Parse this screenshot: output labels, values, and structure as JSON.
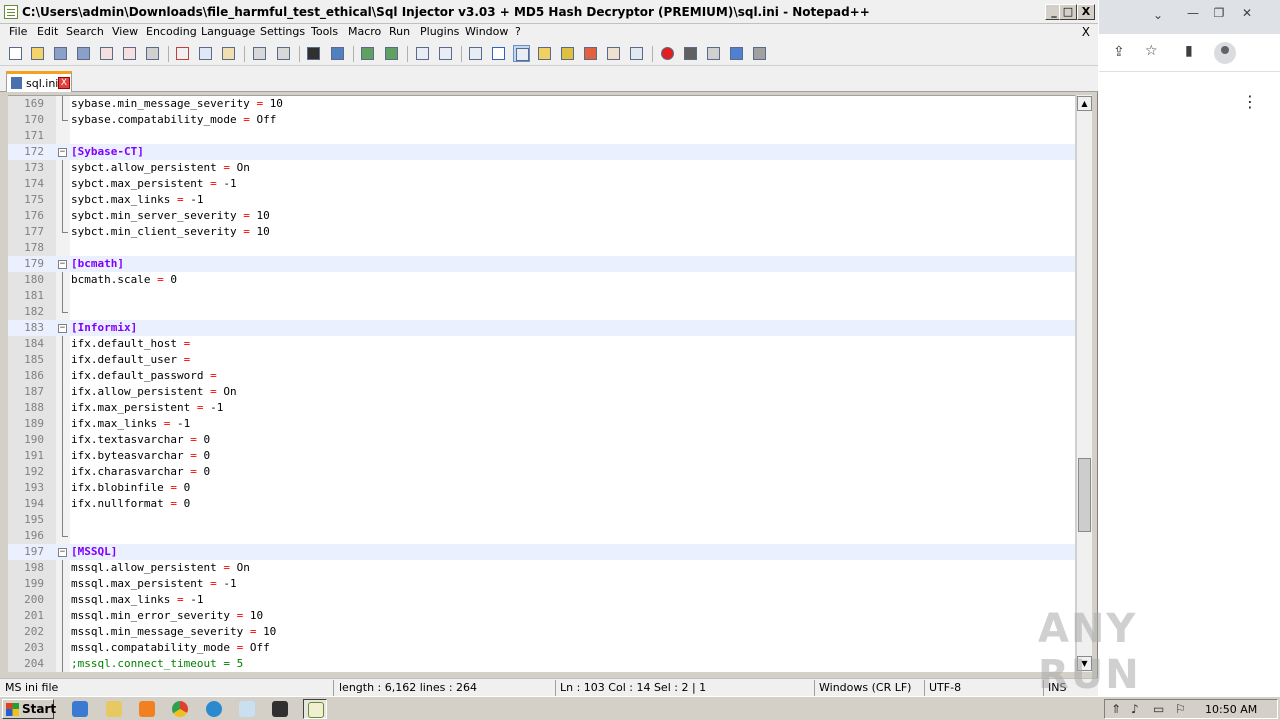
{
  "window": {
    "title": "C:\\Users\\admin\\Downloads\\file_harmful_test_ethical\\Sql Injector v3.03 + MD5 Hash Decryptor (PREMIUM)\\sql.ini - Notepad++",
    "min_label": "_",
    "max_label": "□",
    "close_label": "X"
  },
  "menu": {
    "items": [
      "File",
      "Edit",
      "Search",
      "View",
      "Encoding",
      "Language",
      "Settings",
      "Tools",
      "Macro",
      "Run",
      "Plugins",
      "Window",
      "?"
    ],
    "close_doc": "X"
  },
  "toolbar": {
    "icons": [
      "new-file-icon",
      "open-file-icon",
      "save-icon",
      "save-all-icon",
      "close-icon",
      "close-all-icon",
      "print-icon",
      "cut-icon",
      "copy-icon",
      "paste-icon",
      "undo-icon",
      "redo-icon",
      "find-icon",
      "replace-icon",
      "zoom-in-icon",
      "zoom-out-icon",
      "sync-vertical-icon",
      "sync-horizontal-icon",
      "word-wrap-icon",
      "show-all-chars-icon",
      "indent-guide-icon",
      "user-language-icon",
      "doc-map-icon",
      "function-list-icon",
      "folder-workspace-icon",
      "monitoring-icon",
      "record-macro-icon",
      "stop-record-icon",
      "play-macro-icon",
      "run-macro-multiple-icon",
      "save-macro-icon"
    ]
  },
  "tab": {
    "label": "sql.ini",
    "close": "X"
  },
  "editor": {
    "lines": [
      {
        "n": "169",
        "key": "sybase.min_message_severity",
        "op": "=",
        "val": "10",
        "type": "kv"
      },
      {
        "n": "170",
        "key": "sybase.compatability_mode",
        "op": "=",
        "val": "Off",
        "type": "kv",
        "fold_end": true
      },
      {
        "n": "171",
        "type": "blank"
      },
      {
        "n": "172",
        "section": "[Sybase-CT]",
        "type": "section"
      },
      {
        "n": "173",
        "key": "sybct.allow_persistent",
        "op": "=",
        "val": "On",
        "type": "kv"
      },
      {
        "n": "174",
        "key": "sybct.max_persistent",
        "op": "=",
        "val": "-1",
        "type": "kv"
      },
      {
        "n": "175",
        "key": "sybct.max_links",
        "op": "=",
        "val": "-1",
        "type": "kv"
      },
      {
        "n": "176",
        "key": "sybct.min_server_severity",
        "op": "=",
        "val": "10",
        "type": "kv"
      },
      {
        "n": "177",
        "key": "sybct.min_client_severity",
        "op": "=",
        "val": "10",
        "type": "kv",
        "fold_end": true
      },
      {
        "n": "178",
        "type": "blank"
      },
      {
        "n": "179",
        "section": "[bcmath]",
        "type": "section"
      },
      {
        "n": "180",
        "key": "bcmath.scale",
        "op": "=",
        "val": "0",
        "type": "kv"
      },
      {
        "n": "181",
        "type": "blank",
        "in_fold": true
      },
      {
        "n": "182",
        "type": "blank",
        "fold_end": true
      },
      {
        "n": "183",
        "section": "[Informix]",
        "type": "section"
      },
      {
        "n": "184",
        "key": "ifx.default_host",
        "op": "=",
        "val": "",
        "type": "kv"
      },
      {
        "n": "185",
        "key": "ifx.default_user",
        "op": "=",
        "val": "",
        "type": "kv"
      },
      {
        "n": "186",
        "key": "ifx.default_password",
        "op": "=",
        "val": "",
        "type": "kv"
      },
      {
        "n": "187",
        "key": "ifx.allow_persistent",
        "op": "=",
        "val": "On",
        "type": "kv"
      },
      {
        "n": "188",
        "key": "ifx.max_persistent",
        "op": "=",
        "val": "-1",
        "type": "kv"
      },
      {
        "n": "189",
        "key": "ifx.max_links",
        "op": "=",
        "val": "-1",
        "type": "kv"
      },
      {
        "n": "190",
        "key": "ifx.textasvarchar",
        "op": "=",
        "val": "0",
        "type": "kv"
      },
      {
        "n": "191",
        "key": "ifx.byteasvarchar",
        "op": "=",
        "val": "0",
        "type": "kv"
      },
      {
        "n": "192",
        "key": "ifx.charasvarchar",
        "op": "=",
        "val": "0",
        "type": "kv"
      },
      {
        "n": "193",
        "key": "ifx.blobinfile",
        "op": "=",
        "val": "0",
        "type": "kv"
      },
      {
        "n": "194",
        "key": "ifx.nullformat",
        "op": "=",
        "val": "0",
        "type": "kv"
      },
      {
        "n": "195",
        "type": "blank",
        "in_fold": true
      },
      {
        "n": "196",
        "type": "blank",
        "fold_end": true
      },
      {
        "n": "197",
        "section": "[MSSQL]",
        "type": "section"
      },
      {
        "n": "198",
        "key": "mssql.allow_persistent",
        "op": "=",
        "val": "On",
        "type": "kv"
      },
      {
        "n": "199",
        "key": "mssql.max_persistent",
        "op": "=",
        "val": "-1",
        "type": "kv"
      },
      {
        "n": "200",
        "key": "mssql.max_links",
        "op": "=",
        "val": "-1",
        "type": "kv"
      },
      {
        "n": "201",
        "key": "mssql.min_error_severity",
        "op": "=",
        "val": "10",
        "type": "kv"
      },
      {
        "n": "202",
        "key": "mssql.min_message_severity",
        "op": "=",
        "val": "10",
        "type": "kv"
      },
      {
        "n": "203",
        "key": "mssql.compatability_mode",
        "op": "=",
        "val": "Off",
        "type": "kv"
      },
      {
        "n": "204",
        "comment": ";mssql.connect_timeout = 5",
        "type": "comment"
      }
    ]
  },
  "statusbar": {
    "filetype": "MS ini file",
    "length": "length : 6,162    lines : 264",
    "position": "Ln : 103    Col : 14    Sel : 2 | 1",
    "eol": "Windows (CR LF)",
    "encoding": "UTF-8",
    "mode": "INS"
  },
  "watermark": "ANY RUN",
  "taskbar": {
    "start_label": "Start",
    "clock": "10:50 AM",
    "items": [
      "ie-icon",
      "explorer-icon",
      "media-player-icon",
      "chrome-icon",
      "edge-icon",
      "notepad-icon",
      "sql-injector-icon",
      "notepadpp-icon"
    ]
  },
  "colors": {
    "section": "#8000ff",
    "operator": "#ff0000",
    "comment": "#008000",
    "highlight_line": "#eaf0fe"
  }
}
